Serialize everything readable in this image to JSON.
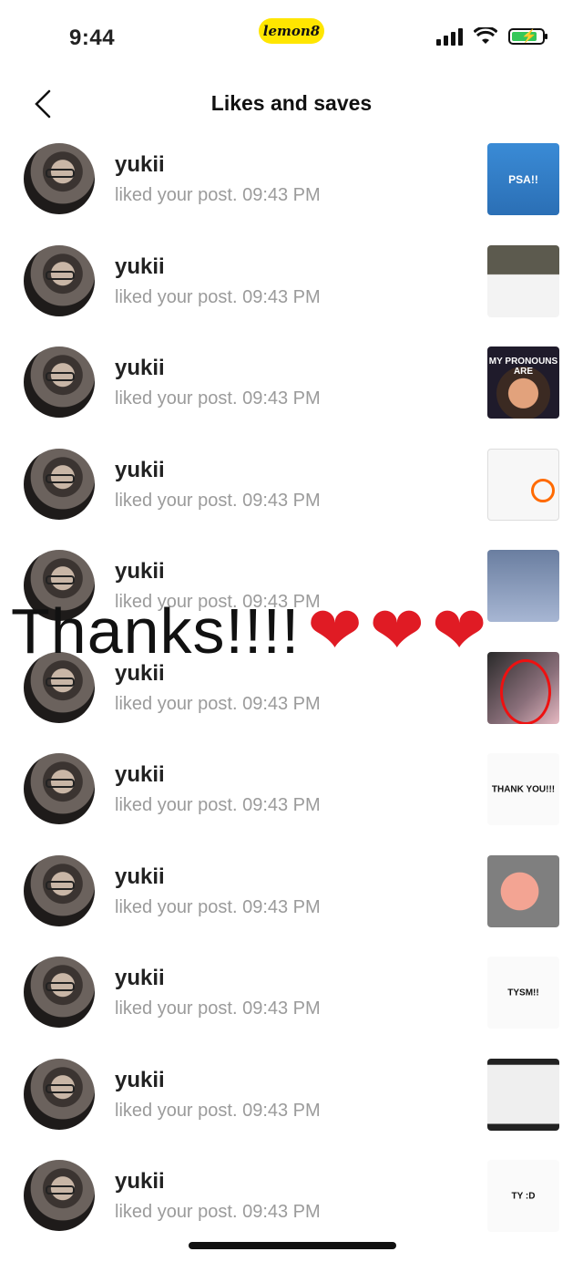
{
  "status_bar": {
    "time": "9:44",
    "brand": "lemon8"
  },
  "header": {
    "title": "Likes and saves"
  },
  "notifications": [
    {
      "name": "yukii",
      "text": "liked your post. 09:43 PM",
      "thumb_label": "PSA!!"
    },
    {
      "name": "yukii",
      "text": "liked your post. 09:43 PM",
      "thumb_label": ""
    },
    {
      "name": "yukii",
      "text": "liked your post. 09:43 PM",
      "thumb_label": "MY PRONOUNS ARE"
    },
    {
      "name": "yukii",
      "text": "liked your post. 09:43 PM",
      "thumb_label": ""
    },
    {
      "name": "yukii",
      "text": "liked your post. 09:43 PM",
      "thumb_label": ""
    },
    {
      "name": "yukii",
      "text": "liked your post. 09:43 PM",
      "thumb_label": ""
    },
    {
      "name": "yukii",
      "text": "liked your post. 09:43 PM",
      "thumb_label": "THANK YOU!!!"
    },
    {
      "name": "yukii",
      "text": "liked your post. 09:43 PM",
      "thumb_label": ""
    },
    {
      "name": "yukii",
      "text": "liked your post. 09:43 PM",
      "thumb_label": "TYSM!!"
    },
    {
      "name": "yukii",
      "text": "liked your post. 09:43 PM",
      "thumb_label": ""
    },
    {
      "name": "yukii",
      "text": "liked your post. 09:43 PM",
      "thumb_label": "TY :D"
    }
  ],
  "overlay": {
    "text": "Thanks!!!!",
    "hearts": [
      "❤",
      "❤",
      "❤"
    ]
  },
  "colors": {
    "brand_yellow": "#ffe600",
    "secondary_text": "#9b9b9b",
    "heart_red": "#e01b24"
  }
}
